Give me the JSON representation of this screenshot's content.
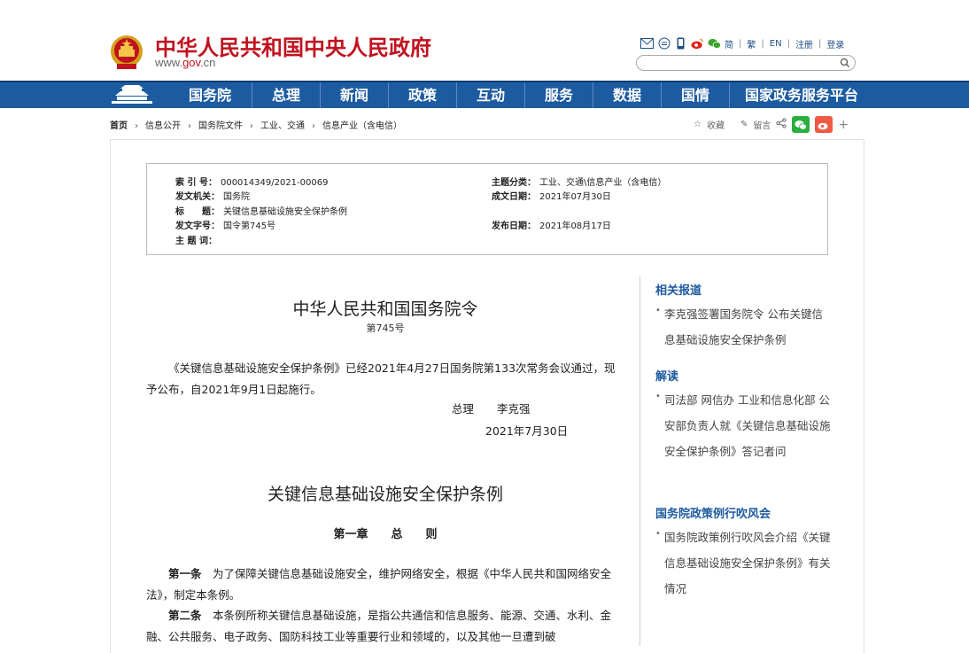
{
  "header": {
    "site_title": "中华人民共和国中央人民政府",
    "site_url_prefix": "www.",
    "site_url_domain": "gov",
    "site_url_suffix": ".cn",
    "lang_links": [
      "简",
      "繁",
      "EN",
      "注册",
      "登录"
    ],
    "search_placeholder": ""
  },
  "nav": {
    "items": [
      "国务院",
      "总理",
      "新闻",
      "政策",
      "互动",
      "服务",
      "数据",
      "国情",
      "国家政务服务平台"
    ]
  },
  "breadcrumb": {
    "items": [
      "首页",
      "信息公开",
      "国务院文件",
      "工业、交通",
      "信息产业（含电信）"
    ]
  },
  "share": {
    "collect": "收藏",
    "comment": "留言"
  },
  "info": {
    "index_label": "索 引 号：",
    "index_value": "000014349/2021-00069",
    "topic_label": "主题分类：",
    "topic_value": "工业、交通\\信息产业（含电信）",
    "issuer_label": "发文机关：",
    "issuer_value": "国务院",
    "date_label": "成文日期：",
    "date_value": "2021年07月30日",
    "title_label": "标　　题：",
    "title_value": "关键信息基础设施安全保护条例",
    "docno_label": "发文字号：",
    "docno_value": "国令第745号",
    "pub_label": "发布日期：",
    "pub_value": "2021年08月17日",
    "keyword_label": "主 题 词："
  },
  "article": {
    "title": "中华人民共和国国务院令",
    "number": "第745号",
    "para1": "《关键信息基础设施安全保护条例》已经2021年4月27日国务院第133次常务会议通过，现予公布，自2021年9月1日起施行。",
    "sign_role": "总理",
    "sign_name": "李克强",
    "sign_date": "2021年7月30日",
    "law_title": "关键信息基础设施安全保护条例",
    "chapter_a": "第一章",
    "chapter_b": "总",
    "chapter_c": "则",
    "art1_head": "第一条",
    "art1_text": "　为了保障关键信息基础设施安全，维护网络安全，根据《中华人民共和国网络安全法》，制定本条例。",
    "art2_head": "第二条",
    "art2_text": "　本条例所称关键信息基础设施，是指公共通信和信息服务、能源、交通、水利、金融、公共服务、电子政务、国防科技工业等重要行业和领域的，以及其他一旦遭到破"
  },
  "sidebar": {
    "sec1_title": "相关报道",
    "sec1_items": [
      "李克强签署国务院令 公布关键信息基础设施安全保护条例"
    ],
    "sec2_title": "解读",
    "sec2_items": [
      "司法部 网信办 工业和信息化部 公安部负责人就《关键信息基础设施安全保护条例》答记者问"
    ],
    "sec3_title": "国务院政策例行吹风会",
    "sec3_items": [
      "国务院政策例行吹风会介绍《关键信息基础设施安全保护条例》有关情况"
    ]
  },
  "colors": {
    "brand_red": "#c1121f",
    "nav_blue": "#1d5ba0",
    "link_blue": "#1d5ba0"
  }
}
